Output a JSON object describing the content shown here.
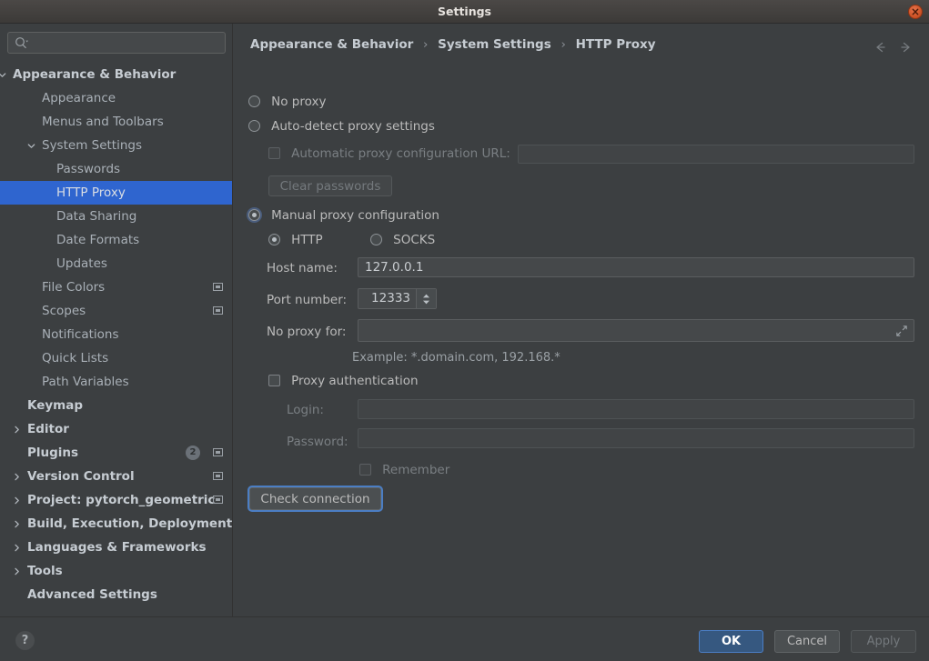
{
  "window": {
    "title": "Settings",
    "close_icon": "close-icon"
  },
  "sidebar": {
    "search": {
      "placeholder": "",
      "value": "",
      "icon": "search-icon"
    },
    "items": [
      {
        "label": "Appearance & Behavior",
        "indent": 14,
        "chevron": "down",
        "bold": true,
        "selected": false
      },
      {
        "label": "Appearance",
        "indent": 46,
        "chevron": "",
        "bold": false,
        "selected": false
      },
      {
        "label": "Menus and Toolbars",
        "indent": 46,
        "chevron": "",
        "bold": false,
        "selected": false
      },
      {
        "label": "System Settings",
        "indent": 46,
        "chevron": "down",
        "bold": false,
        "selected": false
      },
      {
        "label": "Passwords",
        "indent": 62,
        "chevron": "",
        "bold": false,
        "selected": false
      },
      {
        "label": "HTTP Proxy",
        "indent": 62,
        "chevron": "",
        "bold": false,
        "selected": true
      },
      {
        "label": "Data Sharing",
        "indent": 62,
        "chevron": "",
        "bold": false,
        "selected": false
      },
      {
        "label": "Date Formats",
        "indent": 62,
        "chevron": "",
        "bold": false,
        "selected": false
      },
      {
        "label": "Updates",
        "indent": 62,
        "chevron": "",
        "bold": false,
        "selected": false
      },
      {
        "label": "File Colors",
        "indent": 46,
        "chevron": "",
        "bold": false,
        "selected": false,
        "modified": true
      },
      {
        "label": "Scopes",
        "indent": 46,
        "chevron": "",
        "bold": false,
        "selected": false,
        "modified": true
      },
      {
        "label": "Notifications",
        "indent": 46,
        "chevron": "",
        "bold": false,
        "selected": false
      },
      {
        "label": "Quick Lists",
        "indent": 46,
        "chevron": "",
        "bold": false,
        "selected": false
      },
      {
        "label": "Path Variables",
        "indent": 46,
        "chevron": "",
        "bold": false,
        "selected": false
      },
      {
        "label": "Keymap",
        "indent": 30,
        "chevron": "",
        "bold": true,
        "selected": false
      },
      {
        "label": "Editor",
        "indent": 30,
        "chevron": "right",
        "bold": true,
        "selected": false
      },
      {
        "label": "Plugins",
        "indent": 30,
        "chevron": "",
        "bold": true,
        "selected": false,
        "badge": "2",
        "modified": true
      },
      {
        "label": "Version Control",
        "indent": 30,
        "chevron": "right",
        "bold": true,
        "selected": false,
        "modified": true
      },
      {
        "label": "Project: pytorch_geometric",
        "indent": 30,
        "chevron": "right",
        "bold": true,
        "selected": false,
        "modified": true
      },
      {
        "label": "Build, Execution, Deployment",
        "indent": 30,
        "chevron": "right",
        "bold": true,
        "selected": false
      },
      {
        "label": "Languages & Frameworks",
        "indent": 30,
        "chevron": "right",
        "bold": true,
        "selected": false
      },
      {
        "label": "Tools",
        "indent": 30,
        "chevron": "right",
        "bold": true,
        "selected": false
      },
      {
        "label": "Advanced Settings",
        "indent": 30,
        "chevron": "",
        "bold": true,
        "selected": false
      }
    ]
  },
  "content": {
    "breadcrumb": {
      "part1": "Appearance & Behavior",
      "sep1": "›",
      "part2": "System Settings",
      "sep2": "›",
      "part3": "HTTP Proxy"
    },
    "nav": {
      "back_icon": "arrow-left-icon",
      "forward_icon": "arrow-right-icon"
    },
    "no_proxy_label": "No proxy",
    "auto_detect_label": "Auto-detect proxy settings",
    "auto_url_label": "Automatic proxy configuration URL:",
    "auto_url_value": "",
    "clear_passwords_label": "Clear passwords",
    "manual_label": "Manual proxy configuration",
    "http_label": "HTTP",
    "socks_label": "SOCKS",
    "host_label": "Host name:",
    "host_value": "127.0.0.1",
    "port_label": "Port number:",
    "port_value": "12333",
    "no_proxy_for_label": "No proxy for:",
    "no_proxy_for_value": "",
    "example_hint": "Example: *.domain.com, 192.168.*",
    "proxy_auth_label": "Proxy authentication",
    "login_label": "Login:",
    "login_value": "",
    "password_label": "Password:",
    "password_value": "",
    "remember_label": "Remember",
    "check_connection_label": "Check connection"
  },
  "bottom": {
    "help_label": "?",
    "ok_label": "OK",
    "cancel_label": "Cancel",
    "apply_label": "Apply"
  },
  "colors": {
    "background": "#3c3f41",
    "selection": "#2f65cf",
    "primary_button": "#365880",
    "focus_ring": "#4b7ec4",
    "close_button": "#cf5528"
  }
}
